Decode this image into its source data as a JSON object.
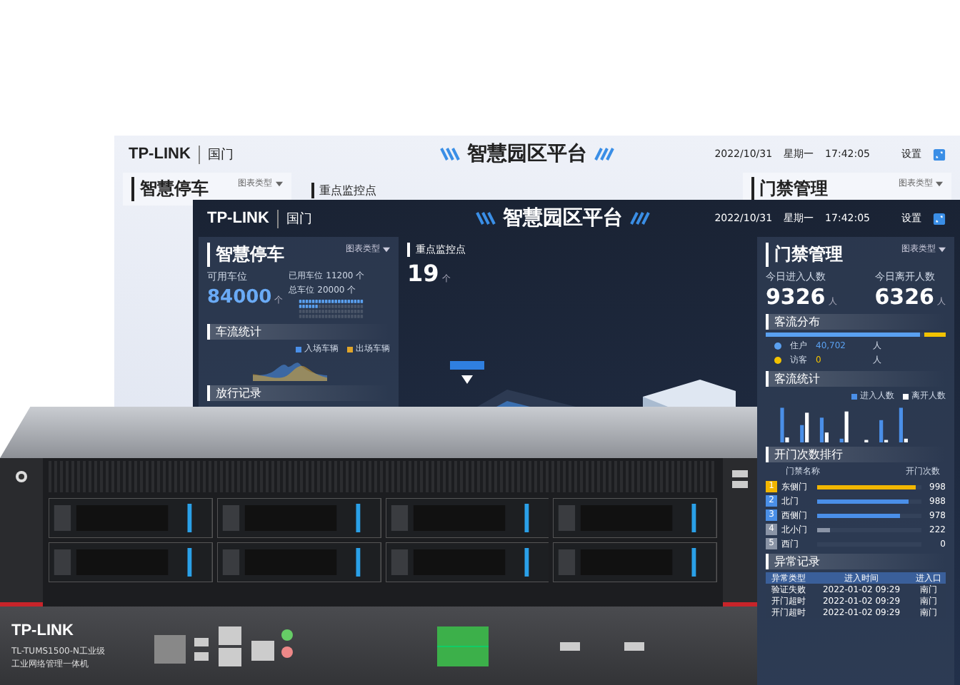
{
  "back_screen": {
    "logo": "TP-LINK",
    "logo_sub": "国门",
    "title": "智慧园区平台",
    "date": "2022/10/31",
    "weekday": "星期一",
    "time": "17:42:05",
    "settings": "设置",
    "panels": [
      {
        "title": "智慧停车",
        "dropdown": "图表类型"
      },
      {
        "title": "重点监控点"
      },
      {
        "title": "门禁管理",
        "dropdown": "图表类型"
      }
    ]
  },
  "front_screen": {
    "logo": "TP-LINK",
    "logo_sub": "国门",
    "title": "智慧园区平台",
    "date": "2022/10/31",
    "weekday": "星期一",
    "time": "17:42:05",
    "settings": "设置",
    "parking": {
      "title": "智慧停车",
      "dropdown": "图表类型",
      "available_label": "可用车位",
      "available": "84000",
      "unit": "个",
      "used": "已用车位 11200 个",
      "total": "总车位 20000 个",
      "traffic_title": "车流统计",
      "legend": [
        {
          "label": "入场车辆",
          "color": "#4a8fe8"
        },
        {
          "label": "出场车辆",
          "color": "#e0a52a"
        }
      ],
      "records_title": "放行记录"
    },
    "monitor": {
      "label": "重点监控点",
      "count": "19",
      "unit": "个"
    },
    "access": {
      "title": "门禁管理",
      "dropdown": "图表类型",
      "stats": [
        {
          "label": "今日进入人数",
          "value": "9326",
          "unit": "人"
        },
        {
          "label": "今日离开人数",
          "value": "6326",
          "unit": "人"
        }
      ],
      "distribution": {
        "title": "客流分布",
        "level": 0.86,
        "items": [
          {
            "name": "住户",
            "value": "40,702",
            "unit": "人",
            "color": "#5aa0f0"
          },
          {
            "name": "访客",
            "value": "0",
            "unit": "人",
            "color": "#f2c200"
          }
        ]
      },
      "flow": {
        "title": "客流统计",
        "legend": [
          {
            "label": "进入人数",
            "color": "#4a8fe8"
          },
          {
            "label": "离开人数",
            "color": "#ffffff"
          }
        ]
      },
      "ranking": {
        "title": "开门次数排行",
        "columns": [
          "门禁名称",
          "开门次数"
        ],
        "rows": [
          {
            "rank": "1",
            "name": "东侧门",
            "count": "998",
            "level": 0.95,
            "color": "#f2b600"
          },
          {
            "rank": "2",
            "name": "北门",
            "count": "988",
            "level": 0.88,
            "color": "#4a8fe8"
          },
          {
            "rank": "3",
            "name": "西侧门",
            "count": "978",
            "level": 0.8,
            "color": "#4a8fe8"
          },
          {
            "rank": "4",
            "name": "北小门",
            "count": "222",
            "level": 0.12,
            "color": "#8a94a6"
          },
          {
            "rank": "5",
            "name": "西门",
            "count": "0",
            "level": 0,
            "color": "#8a94a6"
          }
        ]
      },
      "anomalies": {
        "title": "异常记录",
        "columns": [
          "异常类型",
          "进入时间",
          "进入口"
        ],
        "rows": [
          [
            "验证失败",
            "2022-01-02 09:29",
            "南门"
          ],
          [
            "开门超时",
            "2022-01-02 09:29",
            "南门"
          ],
          [
            "开门超时",
            "2022-01-02 09:29",
            "南门"
          ]
        ]
      }
    }
  },
  "nvr": {
    "logo": "TP-LINK",
    "model": "TL-TUMS1500-N工业级",
    "description": "工业网络管理一体机"
  }
}
